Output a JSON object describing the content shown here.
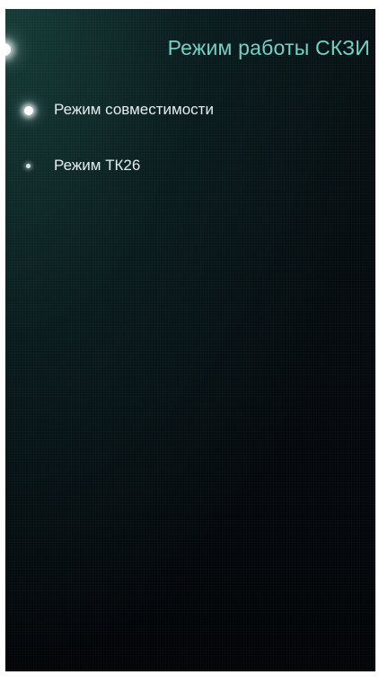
{
  "page": {
    "title": "Режим работы СКЗИ"
  },
  "options": [
    {
      "label": "Режим совместимости",
      "selected": true
    },
    {
      "label": "Режим ТК26",
      "selected": false
    }
  ],
  "colors": {
    "accent": "#74cfc4",
    "text": "#e6ecec",
    "background": "#040a0e"
  }
}
